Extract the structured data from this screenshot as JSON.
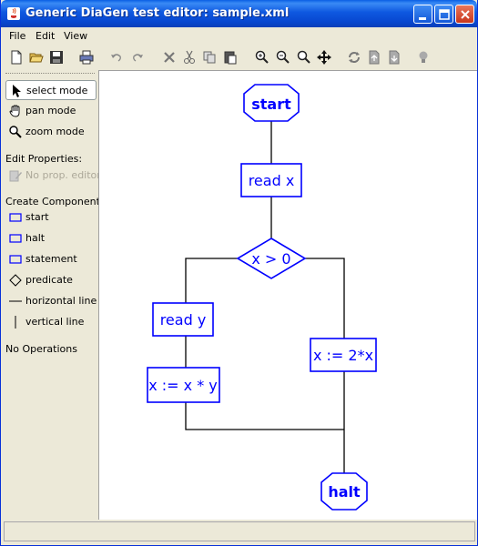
{
  "window": {
    "title": "Generic DiaGen test editor: sample.xml"
  },
  "menu": [
    "File",
    "Edit",
    "View"
  ],
  "toolbar_icons": [
    "new-file-icon",
    "open-folder-icon",
    "save-icon",
    "print-icon",
    "undo-icon",
    "redo-icon",
    "delete-icon",
    "cut-icon",
    "copy-icon",
    "paste-icon",
    "zoom-in-icon",
    "zoom-out-icon",
    "zoom-fit-icon",
    "move-icon",
    "refresh-icon",
    "export-image-icon",
    "import-image-icon",
    "lightbulb-icon"
  ],
  "modes": {
    "select": "select mode",
    "pan": "pan mode",
    "zoom": "zoom mode"
  },
  "edit_properties": {
    "heading": "Edit Properties:",
    "editor": "No prop. editor"
  },
  "create_components": {
    "heading": "Create Components:",
    "items": [
      "start",
      "halt",
      "statement",
      "predicate",
      "horizontal line",
      "vertical line"
    ]
  },
  "operations": "No Operations",
  "diagram": {
    "color": "#0000ff",
    "nodes": {
      "start": "start",
      "read_x": "read x",
      "predicate": "x > 0",
      "read_y": "read y",
      "assign_xy": "x := x * y",
      "assign_2x": "x := 2*x",
      "halt": "halt"
    }
  }
}
